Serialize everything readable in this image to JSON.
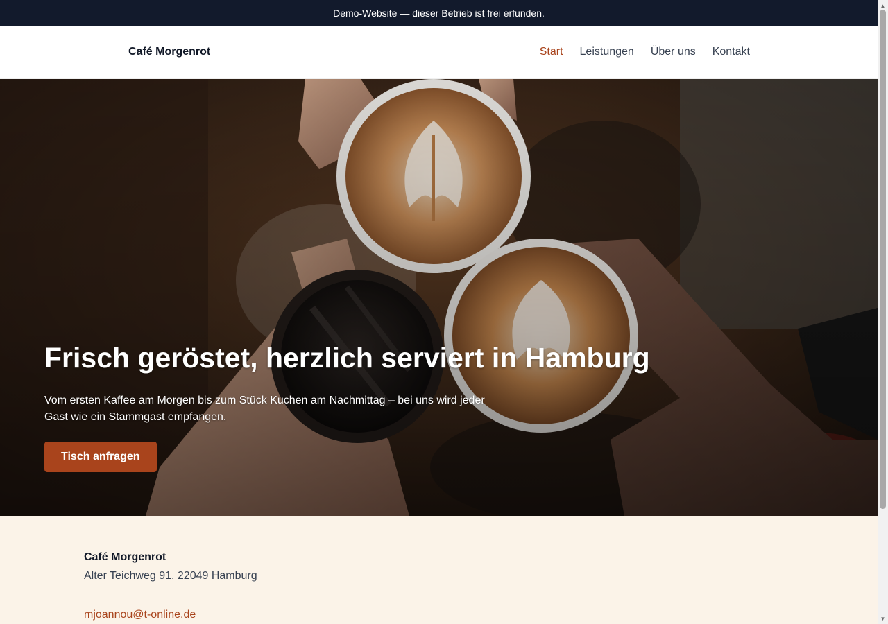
{
  "demo_banner": {
    "text": "Demo-Website — dieser Betrieb ist frei erfunden."
  },
  "header": {
    "brand": "Café Morgenrot",
    "nav": [
      {
        "label": "Start",
        "active": true
      },
      {
        "label": "Leistungen",
        "active": false
      },
      {
        "label": "Über uns",
        "active": false
      },
      {
        "label": "Kontakt",
        "active": false
      }
    ]
  },
  "hero": {
    "title": "Frisch geröstet, herzlich serviert in Hamburg",
    "text": "Vom ersten Kaffee am Morgen bis zum Stück Kuchen am Nachmittag – bei uns wird jeder Gast wie ein Stammgast empfangen.",
    "cta_label": "Tisch anfragen",
    "image": "coffee-cups-toast-photo"
  },
  "contact": {
    "name": "Café Morgenrot",
    "address": "Alter Teichweg 91, 22049 Hamburg",
    "email": "mjoannou@t-online.de"
  },
  "colors": {
    "accent": "#a9441c",
    "banner_bg": "#121a2c",
    "contact_bg": "#fbf3e8"
  }
}
